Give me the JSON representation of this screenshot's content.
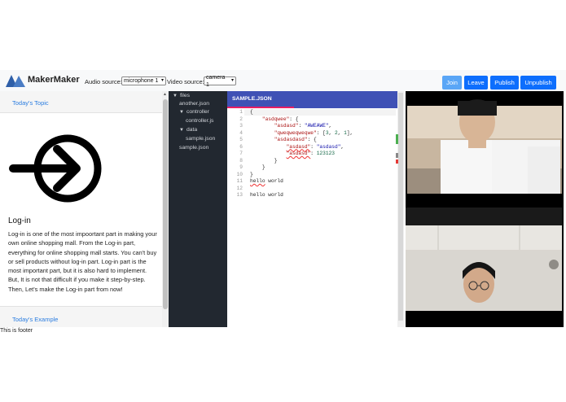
{
  "header": {
    "brand": "MakerMaker",
    "audio_label": "Audio source:",
    "audio_value": "microphone 1",
    "video_label": "Video source:",
    "video_value": "camera 1",
    "buttons": {
      "join": "Join",
      "leave": "Leave",
      "publish": "Publish",
      "unpublish": "Unpublish"
    }
  },
  "topic": {
    "section_title": "Today's Topic",
    "heading": "Log-in",
    "body": "Log-in is one of the most impoortant part in making your own online shopping mall. From the Log-in part, everything for online shopping mall starts. You can't buy or sell products without log-in part. Log-in part is the most important part, but it is also hard to implement. But, It is not that difficult if you make it step-by-step. Then, Let's make the Log-in part from now!",
    "example_title": "Today's Example",
    "footer": "This is footer",
    "icon": "login-arrow-icon"
  },
  "tree": {
    "items": [
      {
        "label": "files",
        "folder": true
      },
      {
        "label": "another.json",
        "folder": false
      },
      {
        "label": "controller",
        "folder": true
      },
      {
        "label": "controller.js",
        "folder": false
      },
      {
        "label": "data",
        "folder": true
      },
      {
        "label": "sample.json",
        "folder": false
      },
      {
        "label": "sample.json",
        "folder": false
      }
    ]
  },
  "editor": {
    "tab_title": "SAMPLE.JSON",
    "line_numbers": [
      "1",
      "2",
      "3",
      "4",
      "5",
      "6",
      "7",
      "8",
      "9",
      "10",
      "11",
      "12",
      "13"
    ],
    "accent": "#3f51b5"
  },
  "colors": {
    "primary_button": "#0d6efd",
    "active_button": "#5aa6f6",
    "link": "#2b7de0",
    "tree_bg": "#222830"
  }
}
